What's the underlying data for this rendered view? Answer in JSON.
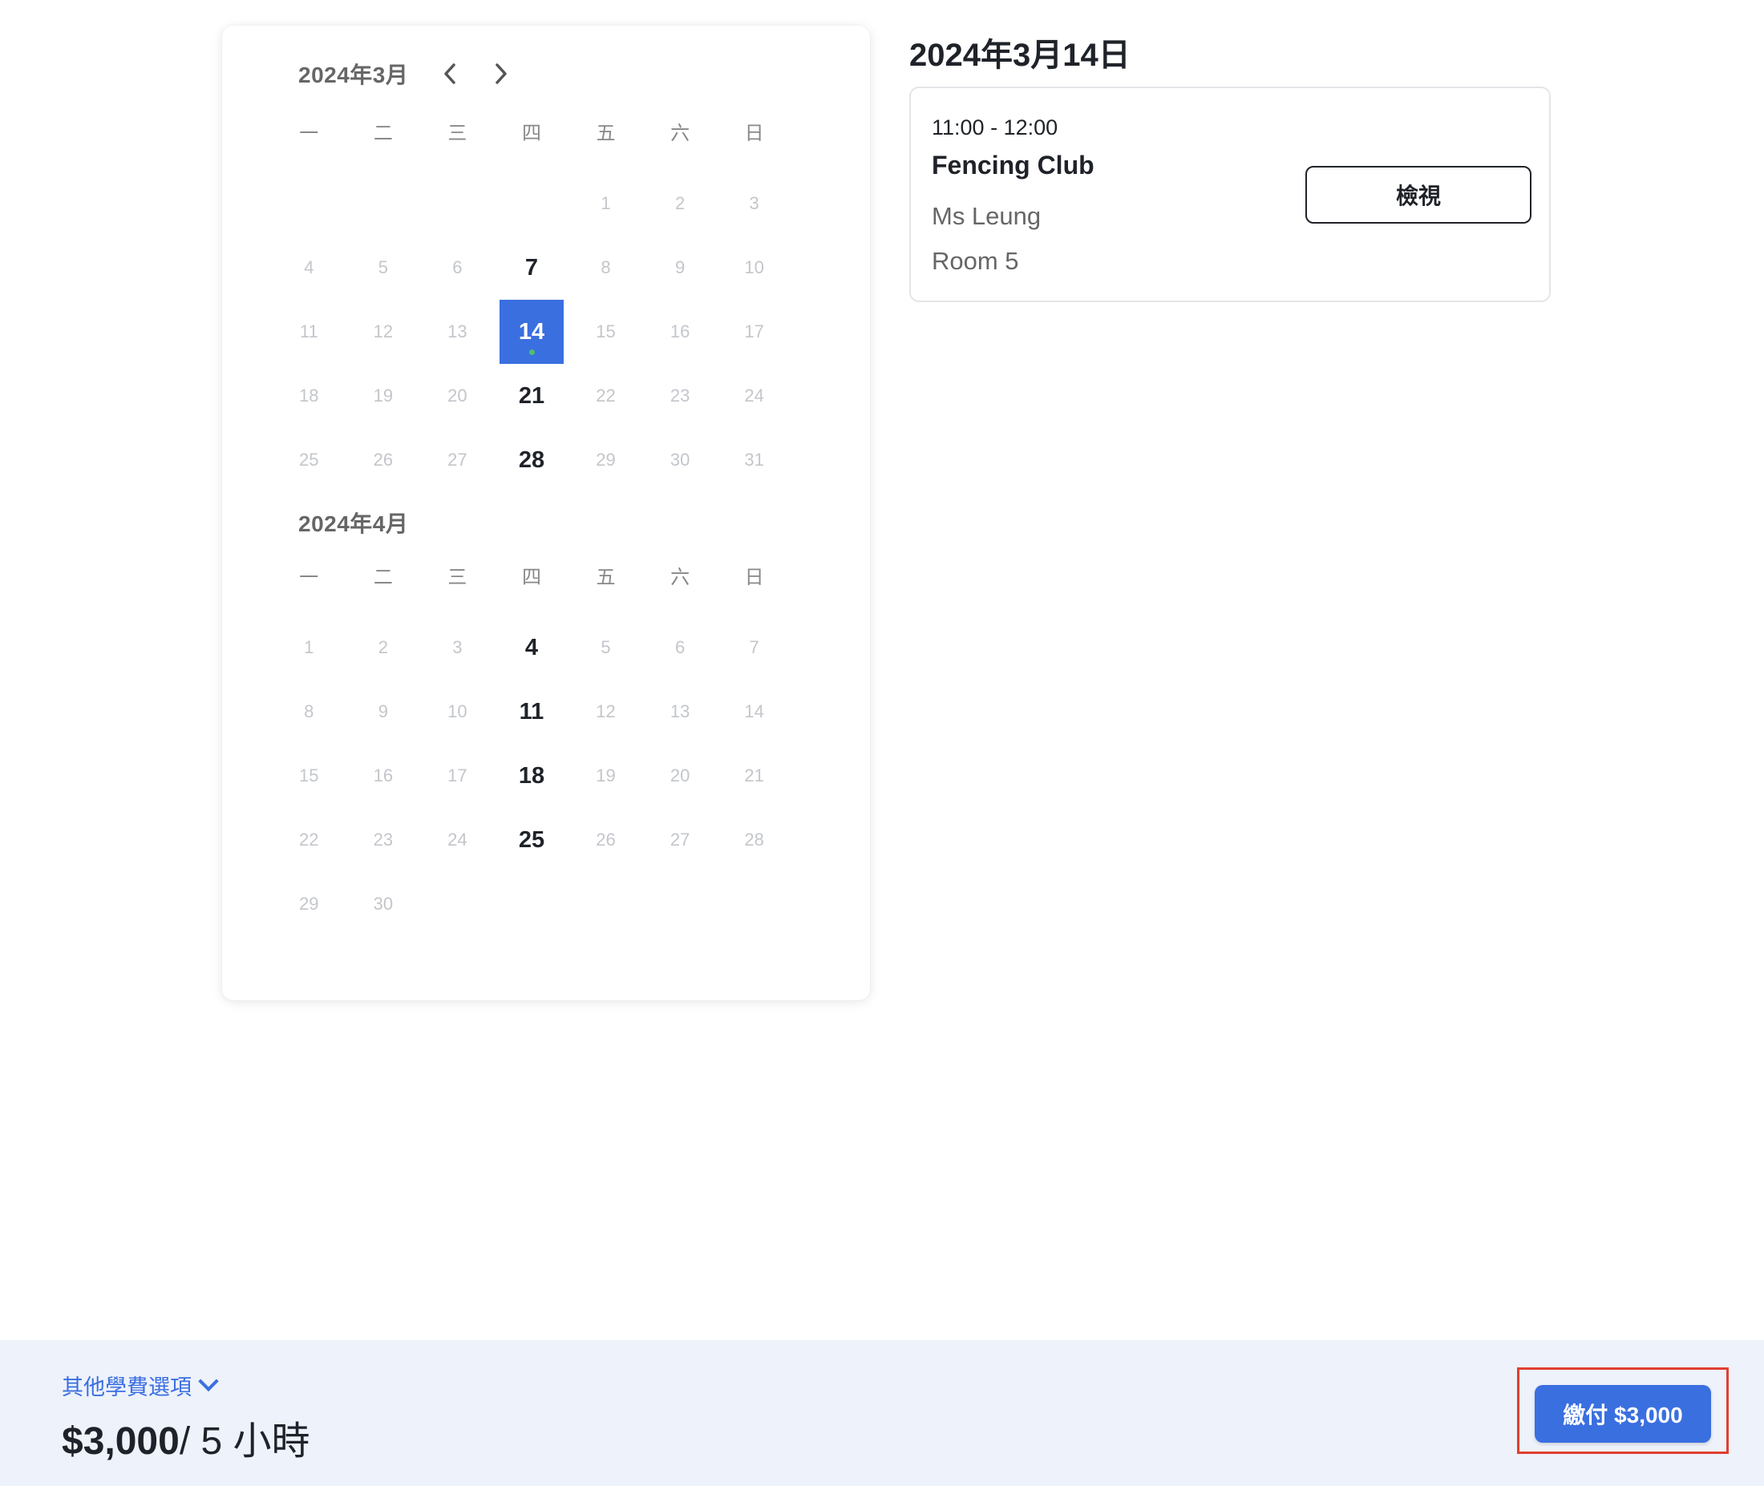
{
  "calendar": {
    "months": [
      {
        "title": "2024年3月",
        "weekdays": [
          "一",
          "二",
          "三",
          "四",
          "五",
          "六",
          "日"
        ],
        "lead_blanks": 4,
        "day_count": 31,
        "active_days": [
          7,
          14,
          21,
          28
        ],
        "selected_day": 14
      },
      {
        "title": "2024年4月",
        "weekdays": [
          "一",
          "二",
          "三",
          "四",
          "五",
          "六",
          "日"
        ],
        "lead_blanks": 0,
        "day_count": 30,
        "active_days": [
          4,
          11,
          18,
          25
        ],
        "selected_day": null
      }
    ],
    "prev_icon": "chevron-left-icon",
    "next_icon": "chevron-right-icon"
  },
  "detail": {
    "date_heading": "2024年3月14日",
    "event": {
      "time": "11:00 - 12:00",
      "title": "Fencing Club",
      "teacher": "Ms Leung",
      "room": "Room 5",
      "view_label": "檢視"
    }
  },
  "footer": {
    "more_options_label": "其他學費選項",
    "price": "$3,000",
    "unit": "/ 5 小時",
    "pay_label": "繳付 $3,000"
  },
  "colors": {
    "accent": "#3a6fe0",
    "event_dot": "#4cc06a",
    "highlight": "#e04030"
  }
}
